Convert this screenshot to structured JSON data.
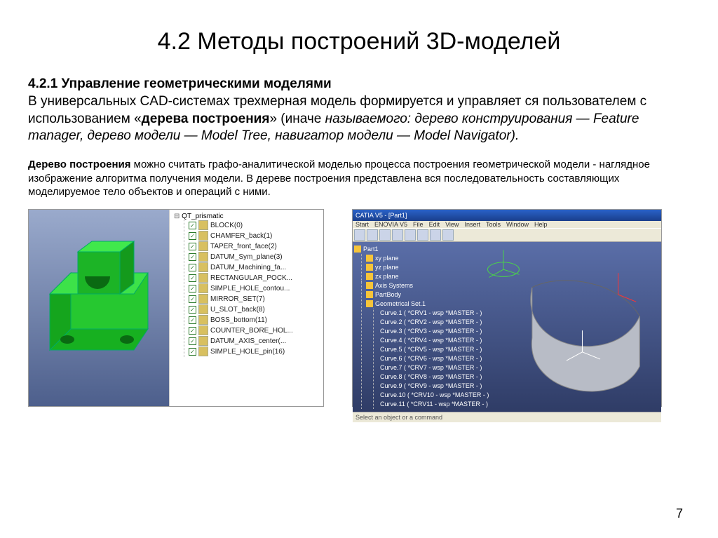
{
  "title": "4.2 Методы построений 3D-моделей",
  "section": {
    "heading": "4.2.1 Управление геометрическими моделями",
    "p1_a": "В универсальных CAD-системах трехмерная модель формируется и управляет ся пользователем с использованием «",
    "p1_bold": "дерева построения",
    "p1_b": "» (иначе ",
    "p1_italic": "называемого: дерево конструирования — Feature manager, дерево модели — Model Tree, навигатор модели — Model Navigator).",
    "p2_bold": "Дерево построения",
    "p2_rest": " можно считать графо-аналитической моделью процесса построения геометрической модели - наглядное изображение алгоритма получения модели. В дереве построения представлена вся последовательность составляющих моделируемое тело объектов и операций с ними."
  },
  "fig1": {
    "tree_root": "QT_prismatic",
    "items": [
      "BLOCK(0)",
      "CHAMFER_back(1)",
      "TAPER_front_face(2)",
      "DATUM_Sym_plane(3)",
      "DATUM_Machining_fa...",
      "RECTANGULAR_POCK...",
      "SIMPLE_HOLE_contou...",
      "MIRROR_SET(7)",
      "U_SLOT_back(8)",
      "BOSS_bottom(11)",
      "COUNTER_BORE_HOL...",
      "DATUM_AXIS_center(...",
      "SIMPLE_HOLE_pin(16)"
    ]
  },
  "fig2": {
    "title": "CATIA V5 - [Part1]",
    "menu": [
      "Start",
      "ENOVIA V5",
      "File",
      "Edit",
      "View",
      "Insert",
      "Tools",
      "Window",
      "Help"
    ],
    "spec_root": "Part1",
    "planes": [
      "xy plane",
      "yz plane",
      "zx plane"
    ],
    "axis": "Axis Systems",
    "body": "PartBody",
    "geomset": "Geometrical Set.1",
    "curves": [
      "Curve.1 ( *CRV1 - wsp *MASTER - )",
      "Curve.2 ( *CRV2 - wsp *MASTER - )",
      "Curve.3 ( *CRV3 - wsp *MASTER - )",
      "Curve.4 ( *CRV4 - wsp *MASTER - )",
      "Curve.5 ( *CRV5 - wsp *MASTER - )",
      "Curve.6 ( *CRV6 - wsp *MASTER - )",
      "Curve.7 ( *CRV7 - wsp *MASTER - )",
      "Curve.8 ( *CRV8 - wsp *MASTER - )",
      "Curve.9 ( *CRV9 - wsp *MASTER - )",
      "Curve.10 ( *CRV10 - wsp *MASTER - )",
      "Curve.11 ( *CRV11 - wsp *MASTER - )"
    ],
    "status": "Select an object or a command"
  },
  "page_number": "7"
}
